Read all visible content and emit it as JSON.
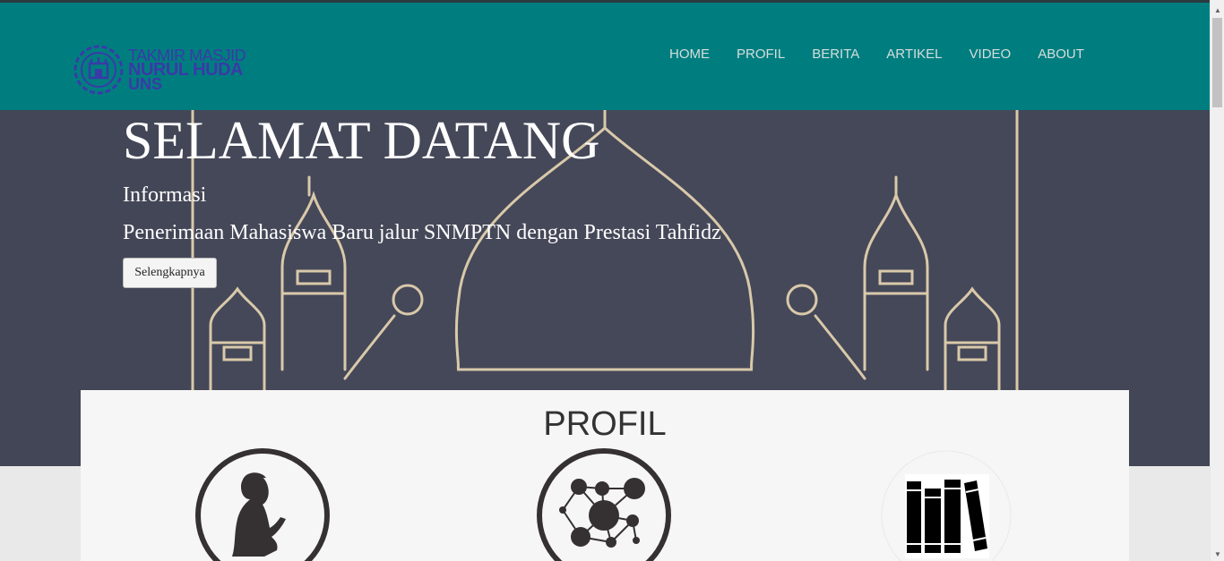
{
  "logo": {
    "line1": "TAKMIR MASJID",
    "line2": "NURUL HUDA",
    "line3": "UNS",
    "color": "#3a3aa8"
  },
  "nav": {
    "items": [
      "HOME",
      "PROFIL",
      "BERITA",
      "ARTIKEL",
      "VIDEO",
      "ABOUT"
    ]
  },
  "hero": {
    "title": "SELAMAT DATANG",
    "subtitle": "Informasi",
    "description": "Penerimaan Mahasiswa Baru jalur SNMPTN dengan Prestasi Tahfidz",
    "button_label": "Selengkapnya"
  },
  "profil": {
    "title": "PROFIL",
    "icons": [
      "praying-person-icon",
      "network-nodes-icon",
      "books-icon"
    ]
  },
  "colors": {
    "navbar": "#007e7f",
    "hero_bg": "#434656",
    "nav_text": "#d6dede"
  }
}
